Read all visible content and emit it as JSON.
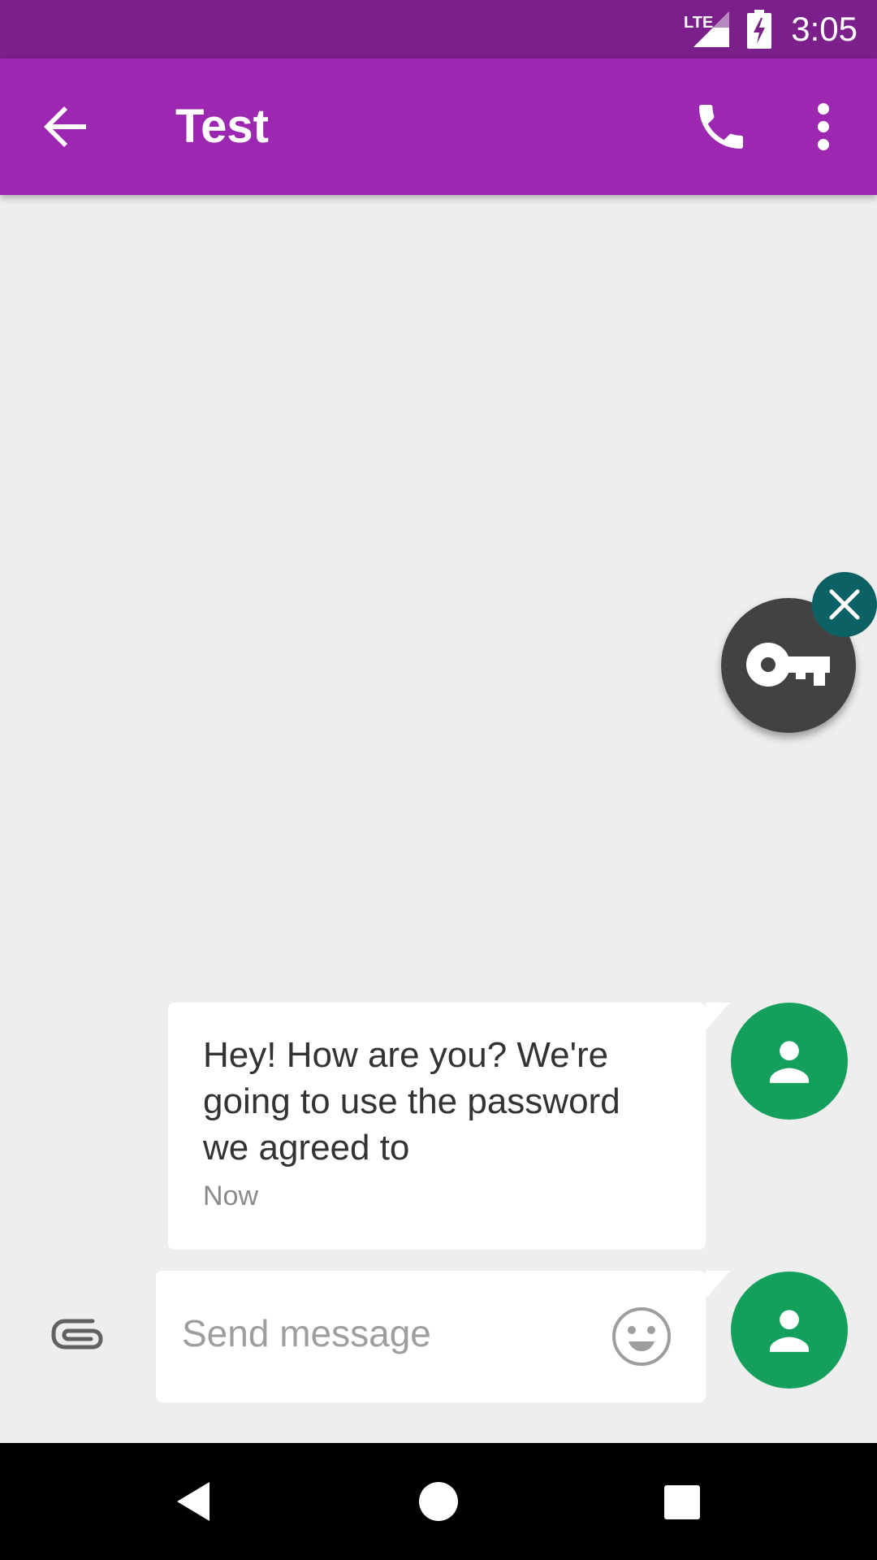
{
  "status_bar": {
    "time": "3:05",
    "network": "LTE",
    "icons": [
      "lte-signal-icon",
      "battery-charging-icon"
    ]
  },
  "app_bar": {
    "title": "Test",
    "icons": [
      "back-arrow-icon",
      "phone-icon",
      "more-vert-icon"
    ]
  },
  "overlay": {
    "icons": [
      "key-icon",
      "close-icon"
    ]
  },
  "messages": [
    {
      "text": "Hey! How are you? We're going to use the password we agreed to",
      "time": "Now"
    }
  ],
  "compose": {
    "placeholder": "Send message",
    "value": "",
    "icons": [
      "attach-icon",
      "emoji-icon",
      "person-icon"
    ]
  },
  "nav_bar": {
    "icons": [
      "nav-back-icon",
      "nav-home-icon",
      "nav-recents-icon"
    ]
  },
  "colors": {
    "status_bar": "#7b1f8a",
    "app_bar": "#9c27b0",
    "avatar": "#14a05c",
    "key_bubble": "#424242",
    "close_bubble": "#0b6163",
    "background": "#eeeeee"
  }
}
